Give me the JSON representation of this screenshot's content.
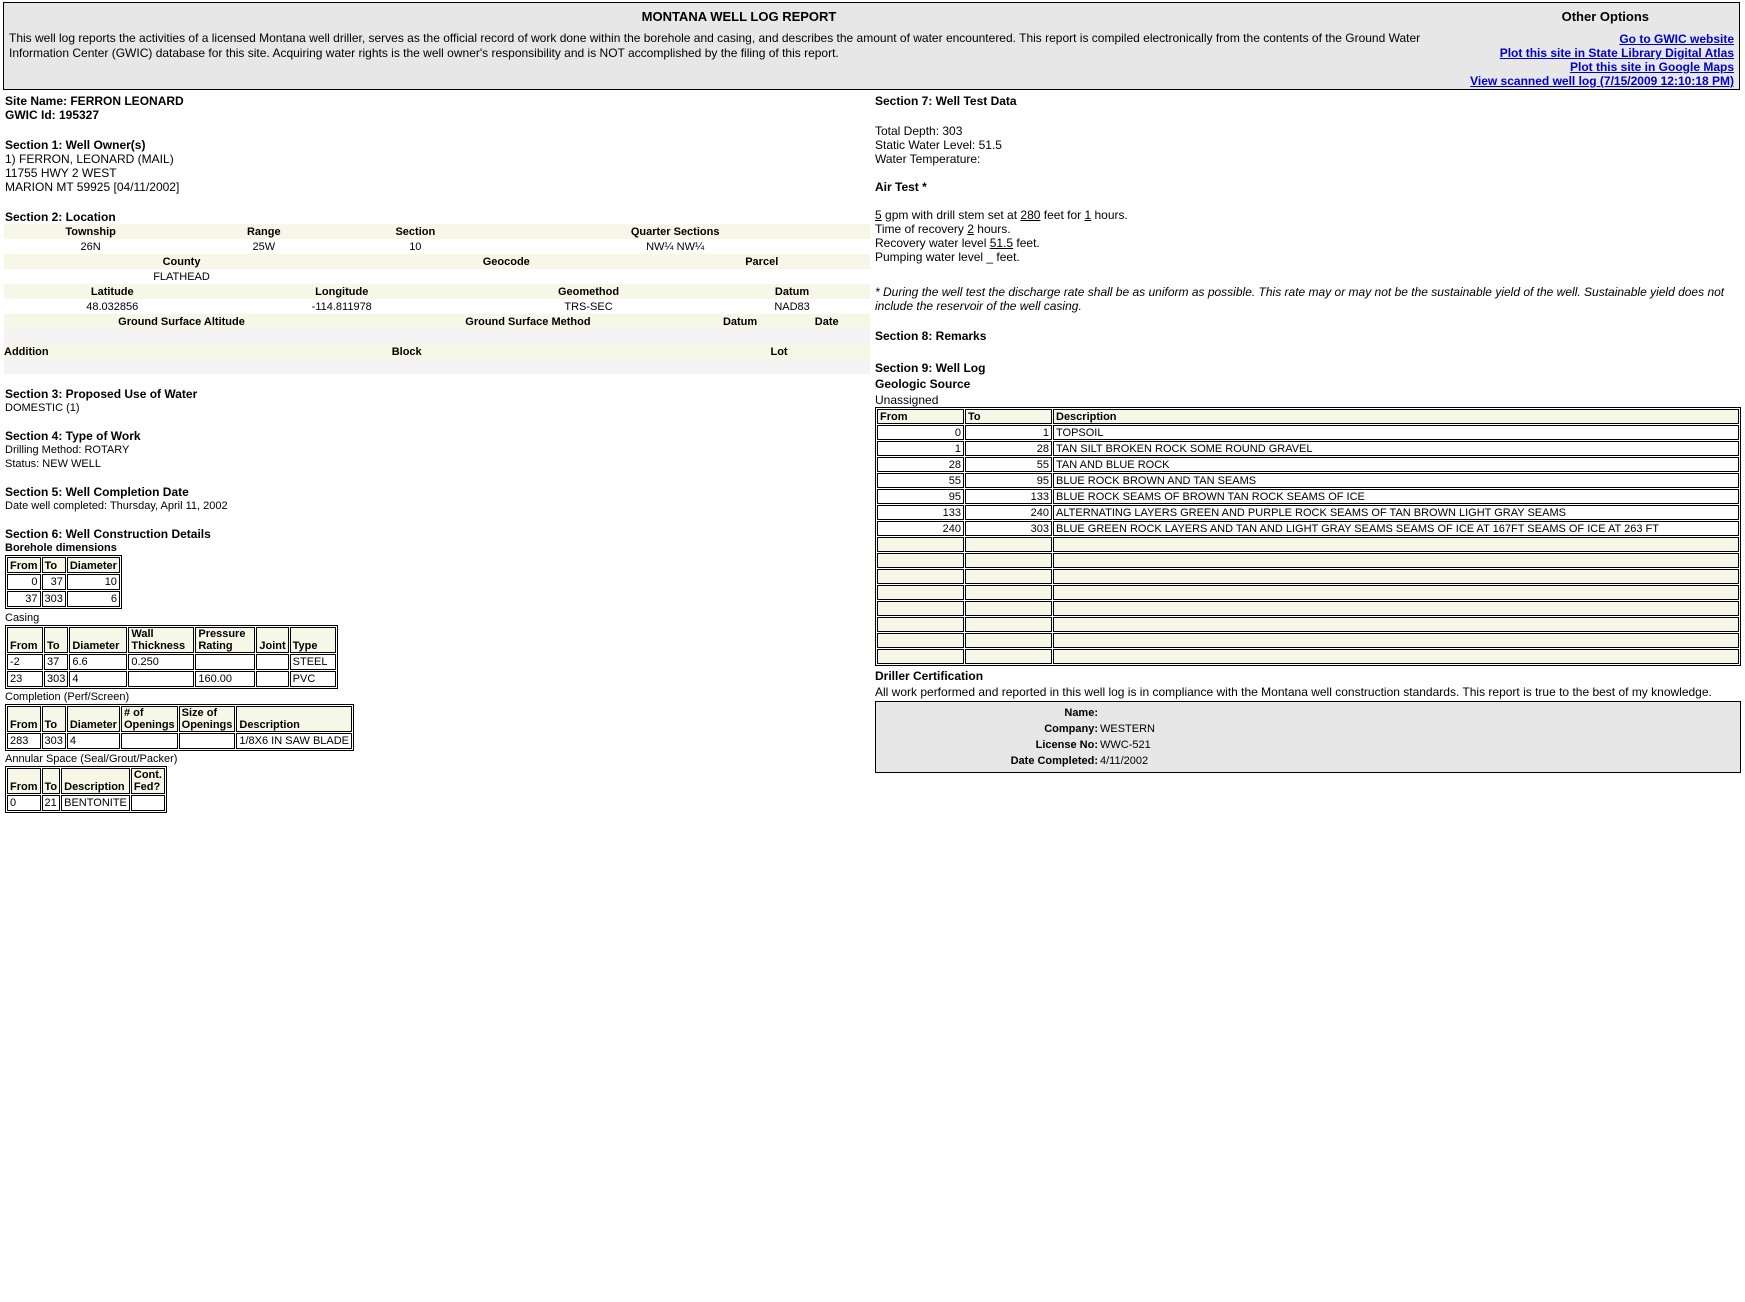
{
  "header": {
    "title": "MONTANA WELL LOG REPORT",
    "intro": "This well log reports the activities of a licensed Montana well driller, serves as the official record of work done within the borehole and casing, and describes the amount of water encountered. This report is compiled electronically from the contents of the Ground Water Information Center (GWIC) database for this site. Acquiring water rights is the well owner's responsibility and is NOT accomplished by the filing of this report.",
    "options_title": "Other Options",
    "links": [
      "Go to GWIC website",
      "Plot this site in State Library Digital Atlas",
      "Plot this site in Google Maps",
      "View scanned well log  (7/15/2009 12:10:18 PM)"
    ]
  },
  "site": {
    "name": "Site Name: FERRON LEONARD",
    "gwic": "GWIC Id: 195327"
  },
  "s1": {
    "title": "Section 1: Well Owner(s)",
    "lines": [
      "1) FERRON, LEONARD (MAIL)",
      "11755 HWY 2 WEST",
      "MARION MT 59925 [04/11/2002]"
    ]
  },
  "s2": {
    "title": "Section 2: Location",
    "row1_h": [
      "Township",
      "Range",
      "Section",
      "Quarter Sections"
    ],
    "row1_v": [
      "26N",
      "25W",
      "10",
      "NW¼ NW¼"
    ],
    "row2_h": [
      "County",
      "Geocode",
      "Parcel"
    ],
    "row2_v": [
      "FLATHEAD",
      "",
      ""
    ],
    "row3_h": [
      "Latitude",
      "Longitude",
      "Geomethod",
      "Datum"
    ],
    "row3_v": [
      "48.032856",
      "-114.811978",
      "TRS-SEC",
      "NAD83"
    ],
    "row4_h": [
      "Ground Surface Altitude",
      "Ground Surface Method",
      "Datum",
      "Date"
    ],
    "row5_h": [
      "Addition",
      "Block",
      "Lot"
    ]
  },
  "s3": {
    "title": "Section 3: Proposed Use of Water",
    "value": "DOMESTIC (1)"
  },
  "s4": {
    "title": "Section 4: Type of Work",
    "method": "Drilling Method: ROTARY",
    "status": "Status: NEW WELL"
  },
  "s5": {
    "title": "Section 5: Well Completion Date",
    "value": "Date well completed: Thursday, April 11, 2002"
  },
  "s6": {
    "title": "Section 6: Well Construction Details",
    "borehole_title": "Borehole dimensions",
    "borehole_h": [
      "From",
      "To",
      "Diameter"
    ],
    "borehole": [
      [
        "0",
        "37",
        "10"
      ],
      [
        "37",
        "303",
        "6"
      ]
    ],
    "casing_title": "Casing",
    "casing_h": [
      "From",
      "To",
      "Diameter",
      "Wall Thickness",
      "Pressure Rating",
      "Joint",
      "Type"
    ],
    "casing": [
      [
        "-2",
        "37",
        "6.6",
        "0.250",
        "",
        "",
        "STEEL"
      ],
      [
        "23",
        "303",
        "4",
        "",
        "160.00",
        "",
        "PVC"
      ]
    ],
    "completion_title": "Completion (Perf/Screen)",
    "completion_h": [
      "From",
      "To",
      "Diameter",
      "# of Openings",
      "Size of Openings",
      "Description"
    ],
    "completion": [
      [
        "283",
        "303",
        "4",
        "",
        "",
        "1/8X6 IN SAW BLADE"
      ]
    ],
    "annular_title": "Annular Space (Seal/Grout/Packer)",
    "annular_h": [
      "From",
      "To",
      "Description",
      "Cont. Fed?"
    ],
    "annular": [
      [
        "0",
        "21",
        "BENTONITE",
        ""
      ]
    ]
  },
  "s7": {
    "title": "Section 7: Well Test Data",
    "depth": "Total Depth: 303",
    "static": "Static Water Level: 51.5",
    "temp": "Water Temperature:",
    "air_title": "Air Test *",
    "gpm": "5",
    "stem": "280",
    "hours": "1",
    "recovery_time": "2",
    "recovery_level": "51.5",
    "pumping_level": "_",
    "t_gpm": " gpm with drill stem set at ",
    "t_feetfor": " feet for ",
    "t_hours": " hours.",
    "t_rec_time": "Time of recovery ",
    "t_rec_level": "Recovery water level ",
    "t_feet": " feet.",
    "t_pump": "Pumping water level ",
    "note": "* During the well test the discharge rate shall be as uniform as possible. This rate may or may not be the sustainable yield of the well. Sustainable yield does not include the reservoir of the well casing."
  },
  "s8": {
    "title": "Section 8: Remarks"
  },
  "s9": {
    "title": "Section 9: Well Log",
    "geo_title": "Geologic Source",
    "geo_value": "Unassigned",
    "headers": [
      "From",
      "To",
      "Description"
    ],
    "rows": [
      [
        "0",
        "1",
        "TOPSOIL"
      ],
      [
        "1",
        "28",
        "TAN SILT BROKEN ROCK SOME ROUND GRAVEL"
      ],
      [
        "28",
        "55",
        "TAN AND BLUE ROCK"
      ],
      [
        "55",
        "95",
        "BLUE ROCK BROWN AND TAN SEAMS"
      ],
      [
        "95",
        "133",
        "BLUE ROCK SEAMS OF BROWN TAN ROCK SEAMS OF ICE"
      ],
      [
        "133",
        "240",
        "ALTERNATING LAYERS GREEN AND PURPLE ROCK SEAMS OF TAN BROWN LIGHT GRAY SEAMS"
      ],
      [
        "240",
        "303",
        "BLUE GREEN ROCK LAYERS AND TAN AND LIGHT GRAY SEAMS SEAMS OF ICE AT 167FT SEAMS OF ICE AT 263 FT"
      ]
    ]
  },
  "cert": {
    "title": "Driller Certification",
    "text": "All work performed and reported in this well log is in compliance with the Montana well construction standards. This report is true to the best of my knowledge.",
    "name_k": "Name:",
    "name_v": "",
    "company_k": "Company:",
    "company_v": "WESTERN",
    "license_k": "License No:",
    "license_v": "WWC-521",
    "date_k": "Date Completed:",
    "date_v": "4/11/2002"
  }
}
